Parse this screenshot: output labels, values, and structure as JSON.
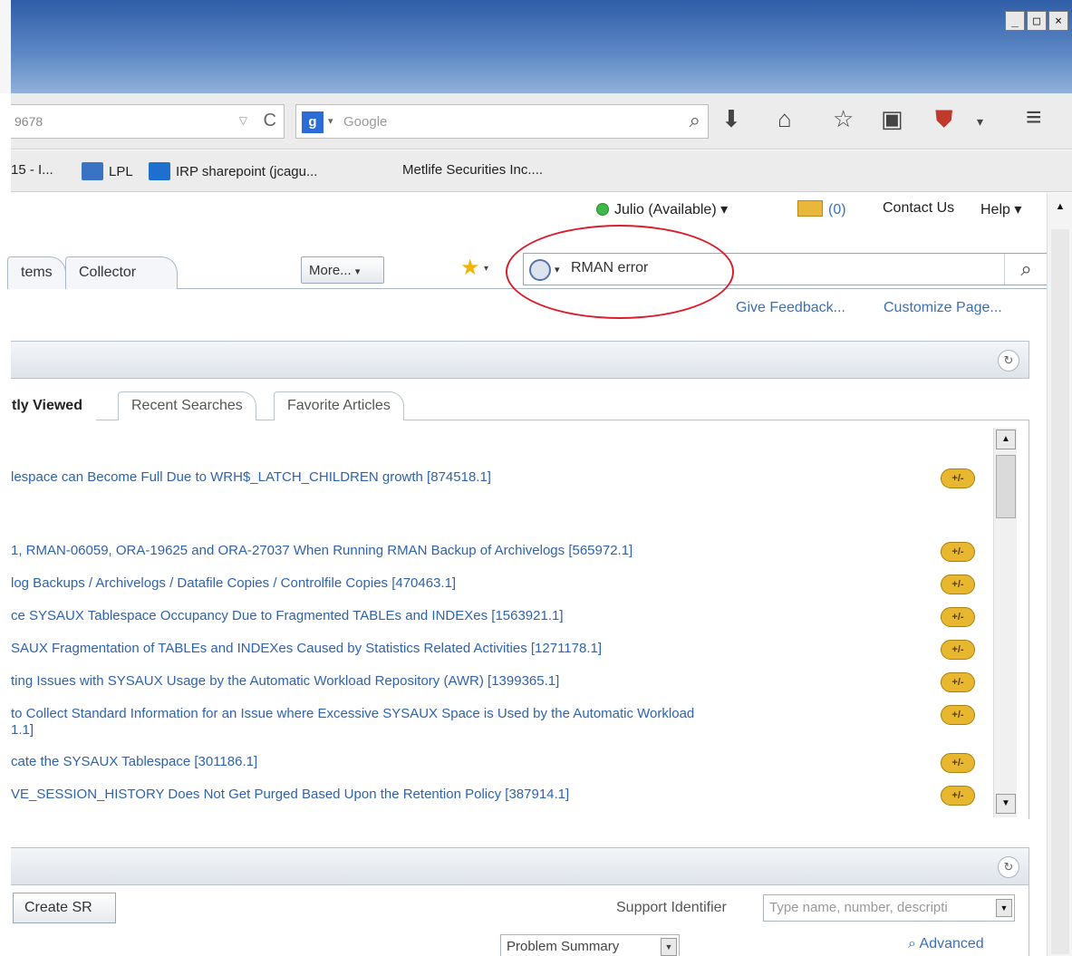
{
  "window": {
    "controls": [
      "_",
      "□",
      "×"
    ]
  },
  "toolbar": {
    "url_text": "9678",
    "url_dropdown": "▽",
    "reload": "C",
    "search_engine_letter": "g",
    "search_engine_drop": "▾",
    "search_placeholder": "Google",
    "search_icon": "⌕",
    "icons": {
      "download": "⬇",
      "home": "⌂",
      "bookmark_star": "☆",
      "clipboard": "▣",
      "extension": "⛊",
      "extension_drop": "▾",
      "menu": "≡"
    }
  },
  "bookmarks": [
    {
      "label": "15 - I...",
      "icon_color": ""
    },
    {
      "label": "LPL",
      "icon_color": "#3a72c4"
    },
    {
      "label": "IRP sharepoint (jcagu...",
      "icon_color": "#1f6fcf"
    },
    {
      "label": "Metlife Securities Inc....",
      "icon_color": ""
    }
  ],
  "header": {
    "user_status": "Julio (Available)",
    "user_drop": "▾",
    "messages": "(0)",
    "contact": "Contact Us",
    "help": "Help",
    "help_drop": "▾"
  },
  "nav": {
    "tabs": [
      "tems",
      "Collector"
    ],
    "more_button": "More...",
    "more_drop": "▾",
    "star_drop": "▾"
  },
  "search": {
    "drop": "▾",
    "query": "RMAN error",
    "go_icon": "⌕"
  },
  "links": {
    "feedback": "Give Feedback...",
    "customize": "Customize Page..."
  },
  "articles_panel": {
    "collapse_icon": "↻",
    "tabs": [
      "tly Viewed",
      "Recent Searches",
      "Favorite Articles"
    ],
    "badge_text": "+/-",
    "items": [
      "lespace can Become Full Due to WRH$_LATCH_CHILDREN growth [874518.1]",
      "1, RMAN-06059, ORA-19625 and ORA-27037 When Running RMAN Backup of Archivelogs [565972.1]",
      "log Backups / Archivelogs / Datafile Copies / Controlfile Copies [470463.1]",
      "ce SYSAUX Tablespace Occupancy Due to Fragmented TABLEs and INDEXes [1563921.1]",
      "SAUX Fragmentation of TABLEs and INDEXes Caused by Statistics Related Activities [1271178.1]",
      "ting Issues with SYSAUX Usage by the Automatic Workload Repository (AWR) [1399365.1]",
      "to Collect Standard Information for an Issue where Excessive SYSAUX Space is Used by the Automatic Workload\n1.1]",
      "cate the SYSAUX Tablespace [301186.1]",
      "VE_SESSION_HISTORY Does Not Get Purged Based Upon the Retention Policy [387914.1]"
    ],
    "scroll_up": "▲",
    "scroll_down": "▼"
  },
  "sr_panel": {
    "collapse_icon": "↻",
    "create_button": "Create SR",
    "support_identifier_label": "Support Identifier",
    "support_identifier_placeholder": "Type name, number, descripti",
    "field_drop": "▼",
    "problem_summary": "Problem Summary",
    "advanced_icon": "⌕",
    "advanced": "Advanced"
  },
  "page_scroll": {
    "up": "▲"
  }
}
